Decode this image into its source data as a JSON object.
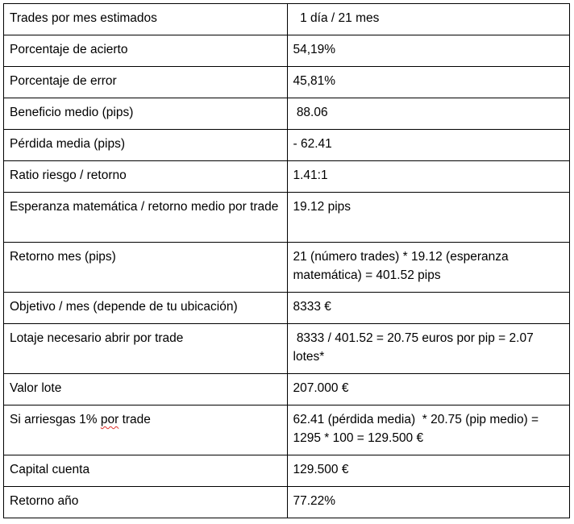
{
  "rows": [
    {
      "label": "Trades por mes estimados",
      "value": "  1 día / 21 mes"
    },
    {
      "label": "Porcentaje de acierto",
      "value": "54,19%"
    },
    {
      "label": "Porcentaje de error",
      "value": "45,81%"
    },
    {
      "label": "Beneficio medio (pips)",
      "value": " 88.06"
    },
    {
      "label": "Pérdida media (pips)",
      "value": "- 62.41"
    },
    {
      "label": "Ratio riesgo / retorno",
      "value": "1.41:1"
    },
    {
      "label": "Esperanza matemática / retorno medio por trade",
      "value": "19.12 pips"
    },
    {
      "label": "Retorno mes (pips)",
      "value": "21 (número trades) * 19.12 (esperanza matemática) = 401.52 pips"
    },
    {
      "label": "Objetivo / mes (depende de tu ubicación)",
      "value": "8333 €"
    },
    {
      "label": "Lotaje necesario abrir por trade",
      "value": " 8333 / 401.52 = 20.75 euros por pip = 2.07 lotes*"
    },
    {
      "label": "Valor lote",
      "value": "207.000 €"
    },
    {
      "label_pre": "Si arriesgas 1% ",
      "label_marked": "por",
      "label_post": " trade",
      "value": "62.41 (pérdida media)  * 20.75 (pip medio) = 1295 * 100 = 129.500 €"
    },
    {
      "label": "Capital cuenta",
      "value": "129.500 €"
    },
    {
      "label": "Retorno año",
      "value": "77.22%"
    }
  ]
}
